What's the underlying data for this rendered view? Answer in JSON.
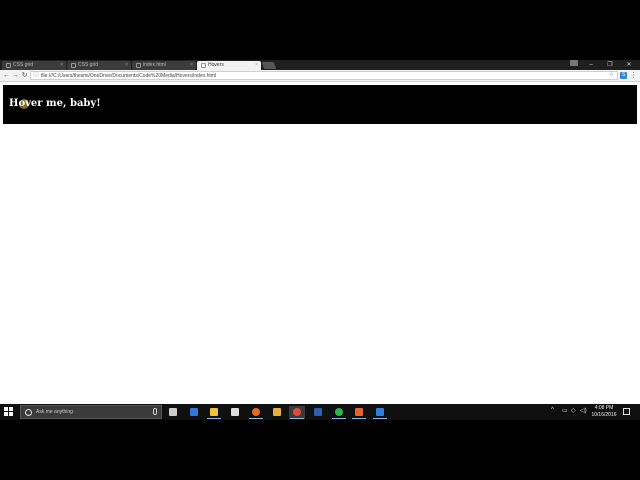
{
  "browser": {
    "tabs": [
      {
        "label": "CSS grid",
        "active": false
      },
      {
        "label": "CSS grid",
        "active": false
      },
      {
        "label": "index.html",
        "active": false
      },
      {
        "label": "Hovers",
        "active": true
      }
    ],
    "window_controls": {
      "minimize": "–",
      "restore": "❐",
      "close": "✕"
    },
    "nav": {
      "back": "←",
      "forward": "→",
      "reload": "↻"
    },
    "address": "file:///C:/Users/thesmi/OneDrive/Documents/Code%20Media/Hovers/index.html",
    "info_glyph": "ⓘ",
    "star_glyph": "☆",
    "extension_glyph": "S",
    "menu_glyph": "⋮"
  },
  "page": {
    "hover_text": "Hover me, baby!",
    "bar_color": "#000000",
    "text_color": "#ffffff"
  },
  "taskbar": {
    "search_placeholder": "Ask me anything",
    "apps": [
      {
        "name": "task-view",
        "color": "#cccccc",
        "running": false
      },
      {
        "name": "edge",
        "color": "#3277d9",
        "running": false
      },
      {
        "name": "file-explorer",
        "color": "#f0c23a",
        "running": true
      },
      {
        "name": "store",
        "color": "#dddddd",
        "running": false
      },
      {
        "name": "firefox",
        "color": "#e66b1f",
        "running": true
      },
      {
        "name": "git",
        "color": "#e8b13b",
        "running": false
      },
      {
        "name": "chrome",
        "color": "#dd4b39",
        "running": true
      },
      {
        "name": "powershell",
        "color": "#2b5fb0",
        "running": false
      },
      {
        "name": "spotify",
        "color": "#2fb34a",
        "running": true
      },
      {
        "name": "app-orange",
        "color": "#e8622c",
        "running": true
      },
      {
        "name": "app-blue",
        "color": "#2f7fd6",
        "running": true
      }
    ],
    "tray": {
      "chevron": "^",
      "battery": "▭",
      "network": "◇",
      "volume": "◁)"
    },
    "time": "4:08 PM",
    "date": "10/16/2016"
  }
}
